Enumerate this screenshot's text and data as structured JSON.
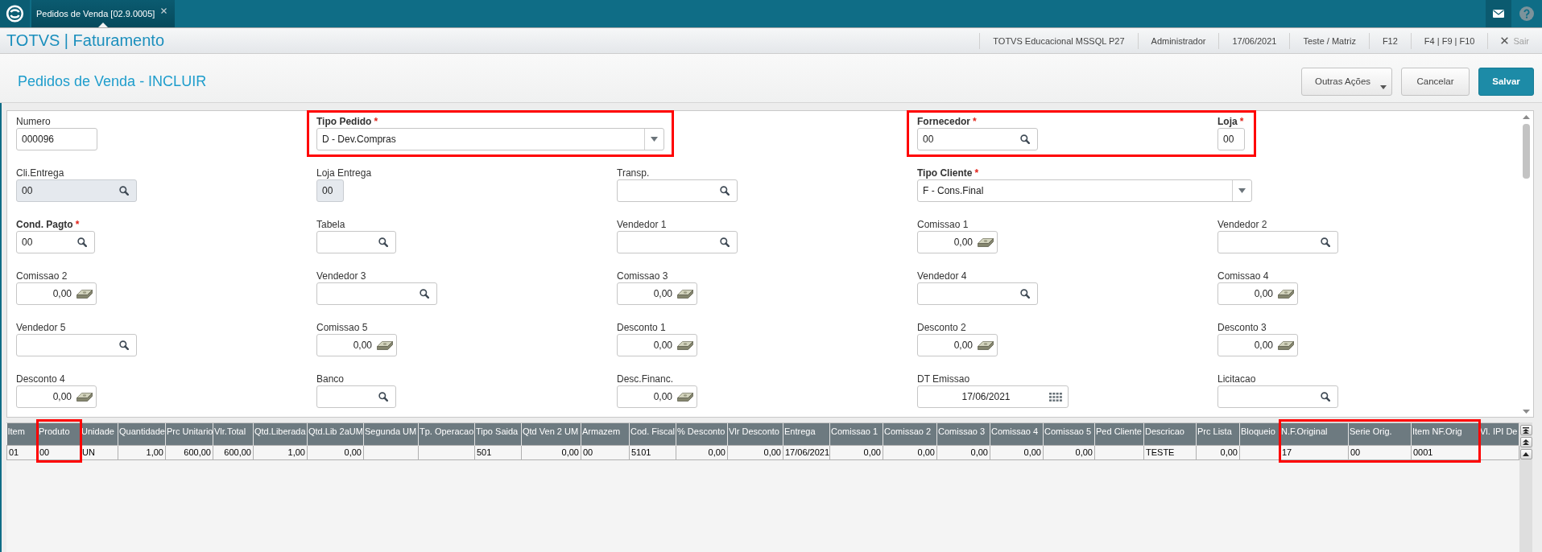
{
  "top_bar": {
    "tabs": [
      {
        "label": "Pedidos de Venda [02.9.0005]",
        "selected": true
      }
    ]
  },
  "header": {
    "title": "TOTVS | Faturamento",
    "info": [
      "TOTVS Educacional MSSQL P27",
      "Administrador",
      "17/06/2021",
      "Teste / Matriz",
      "F12",
      "F4 | F9 | F10"
    ],
    "exit_label": "Sair"
  },
  "toolbar": {
    "title": "Pedidos de Venda - INCLUIR",
    "buttons": [
      {
        "label": "Outras Ações",
        "kind": "menu"
      },
      {
        "label": "Cancelar",
        "kind": "secondary"
      },
      {
        "label": "Salvar",
        "kind": "primary"
      }
    ]
  },
  "form": {
    "rows": [
      {
        "fields": [
          {
            "label": "Numero",
            "kind": "text",
            "value": "000096",
            "required": false,
            "disabled": false,
            "highlighted": false
          },
          {
            "label": "Tipo Pedido",
            "mark": "*",
            "kind": "select",
            "value": "D - Dev.Compras",
            "required": true,
            "disabled": false,
            "highlighted": true
          },
          {
            "kind": "group",
            "highlighted": true,
            "fields": [
              {
                "label": "Fornecedor",
                "mark": "*",
                "kind": "lookup",
                "value": "00",
                "required": true,
                "disabled": false
              },
              {
                "label": "Loja",
                "mark": "*",
                "kind": "text",
                "value": "00",
                "required": true,
                "disabled": false
              }
            ]
          }
        ]
      },
      {
        "fields": [
          {
            "label": "Cli.Entrega",
            "kind": "lookup",
            "value": "00",
            "required": false,
            "disabled": true,
            "highlighted": false
          },
          {
            "label": "Loja Entrega",
            "kind": "text",
            "value": "00",
            "required": false,
            "disabled": true,
            "highlighted": false
          },
          {
            "label": "Transp.",
            "kind": "lookup",
            "required": false,
            "disabled": false,
            "highlighted": false
          },
          {
            "label": "Tipo Cliente",
            "mark": "*",
            "kind": "select",
            "value": "F - Cons.Final",
            "required": true,
            "disabled": false,
            "highlighted": false
          }
        ]
      },
      {
        "fields": [
          {
            "label": "Cond. Pagto",
            "mark": "*",
            "kind": "lookup",
            "value": "00",
            "required": true,
            "disabled": false,
            "highlighted": false
          },
          {
            "label": "Tabela",
            "kind": "lookup",
            "required": false,
            "disabled": false,
            "highlighted": false
          },
          {
            "label": "Vendedor 1",
            "kind": "lookup",
            "required": false,
            "disabled": false,
            "highlighted": false
          },
          {
            "label": "Comissao 1",
            "kind": "money",
            "value": "0,00",
            "required": false,
            "disabled": false,
            "highlighted": false
          },
          {
            "label": "Vendedor 2",
            "kind": "lookup",
            "required": false,
            "disabled": false,
            "highlighted": false
          }
        ]
      },
      {
        "fields": [
          {
            "label": "Comissao 2",
            "kind": "money",
            "value": "0,00",
            "required": false,
            "disabled": false,
            "highlighted": false
          },
          {
            "label": "Vendedor 3",
            "kind": "lookup",
            "required": false,
            "disabled": false,
            "highlighted": false
          },
          {
            "label": "Comissao 3",
            "kind": "money",
            "value": "0,00",
            "required": false,
            "disabled": false,
            "highlighted": false
          },
          {
            "label": "Vendedor 4",
            "kind": "lookup",
            "required": false,
            "disabled": false,
            "highlighted": false
          },
          {
            "label": "Comissao 4",
            "kind": "money",
            "value": "0,00",
            "required": false,
            "disabled": false,
            "highlighted": false
          }
        ]
      },
      {
        "fields": [
          {
            "label": "Vendedor 5",
            "kind": "lookup",
            "required": false,
            "disabled": false,
            "highlighted": false
          },
          {
            "label": "Comissao 5",
            "kind": "money",
            "value": "0,00",
            "required": false,
            "disabled": false,
            "highlighted": false
          },
          {
            "label": "Desconto 1",
            "kind": "money",
            "value": "0,00",
            "required": false,
            "disabled": false,
            "highlighted": false
          },
          {
            "label": "Desconto 2",
            "kind": "money",
            "value": "0,00",
            "required": false,
            "disabled": false,
            "highlighted": false
          },
          {
            "label": "Desconto 3",
            "kind": "money",
            "value": "0,00",
            "required": false,
            "disabled": false,
            "highlighted": false
          }
        ]
      },
      {
        "fields": [
          {
            "label": "Desconto 4",
            "kind": "money",
            "value": "0,00",
            "required": false,
            "disabled": false,
            "highlighted": false
          },
          {
            "label": "Banco",
            "kind": "lookup",
            "required": false,
            "disabled": false,
            "highlighted": false
          },
          {
            "label": "Desc.Financ.",
            "kind": "money",
            "value": "0,00",
            "required": false,
            "disabled": false,
            "highlighted": false
          },
          {
            "label": "DT Emissao",
            "kind": "date",
            "value": "17/06/2021",
            "required": false,
            "disabled": false,
            "highlighted": false
          },
          {
            "label": "Licitacao",
            "kind": "lookup",
            "required": false,
            "disabled": false,
            "highlighted": false
          }
        ]
      }
    ]
  },
  "table": {
    "columns": [
      {
        "label": "Item",
        "kind": "text",
        "highlighted": false
      },
      {
        "label": "Produto",
        "kind": "text",
        "highlighted": true
      },
      {
        "label": "Unidade",
        "kind": "text",
        "highlighted": false
      },
      {
        "label": "Quantidade",
        "kind": "numeric",
        "highlighted": false
      },
      {
        "label": "Prc Unitario",
        "kind": "numeric",
        "highlighted": false
      },
      {
        "label": "Vlr.Total",
        "kind": "numeric",
        "highlighted": false
      },
      {
        "label": "Qtd.Liberada",
        "kind": "numeric",
        "highlighted": false
      },
      {
        "label": "Qtd.Lib 2aUM",
        "kind": "numeric",
        "highlighted": false
      },
      {
        "label": "Segunda UM",
        "highlighted": false
      },
      {
        "label": "Tp. Operacao",
        "highlighted": false
      },
      {
        "label": "Tipo Saida",
        "kind": "text",
        "highlighted": false
      },
      {
        "label": "Qtd Ven 2 UM",
        "kind": "numeric",
        "highlighted": false
      },
      {
        "label": "Armazem",
        "kind": "text",
        "highlighted": false
      },
      {
        "label": "Cod. Fiscal",
        "kind": "text",
        "highlighted": false
      },
      {
        "label": "% Desconto",
        "kind": "numeric",
        "highlighted": false
      },
      {
        "label": "Vlr Desconto",
        "kind": "numeric",
        "highlighted": false
      },
      {
        "label": "Entrega",
        "kind": "text",
        "highlighted": false
      },
      {
        "label": "Comissao 1",
        "kind": "numeric",
        "highlighted": false
      },
      {
        "label": "Comissao 2",
        "kind": "numeric",
        "highlighted": false
      },
      {
        "label": "Comissao 3",
        "kind": "numeric",
        "highlighted": false
      },
      {
        "label": "Comissao 4",
        "kind": "numeric",
        "highlighted": false
      },
      {
        "label": "Comissao 5",
        "kind": "numeric",
        "highlighted": false
      },
      {
        "label": "Ped Cliente",
        "highlighted": false
      },
      {
        "label": "Descricao",
        "kind": "text",
        "highlighted": false
      },
      {
        "label": "Prc Lista",
        "kind": "numeric",
        "highlighted": false
      },
      {
        "label": "Bloqueio",
        "highlighted": false
      },
      {
        "label": "N.F.Original",
        "kind": "text",
        "highlighted": true
      },
      {
        "label": "Serie Orig.",
        "kind": "text",
        "highlighted": true
      },
      {
        "label": "Item NF.Orig",
        "kind": "text",
        "highlighted": true
      },
      {
        "label": "Vl. IPI De",
        "highlighted": false
      }
    ],
    "rows": [
      {
        "cells": [
          "01",
          "00",
          "UN",
          "1,00",
          "600,00",
          "600,00",
          "1,00",
          "0,00",
          null,
          null,
          "501",
          "0,00",
          "00",
          "5101",
          "0,00",
          "0,00",
          "17/06/2021",
          "0,00",
          "0,00",
          "0,00",
          "0,00",
          "0,00",
          null,
          "TESTE",
          "0,00",
          null,
          "17",
          "00",
          "0001",
          null
        ]
      }
    ]
  }
}
